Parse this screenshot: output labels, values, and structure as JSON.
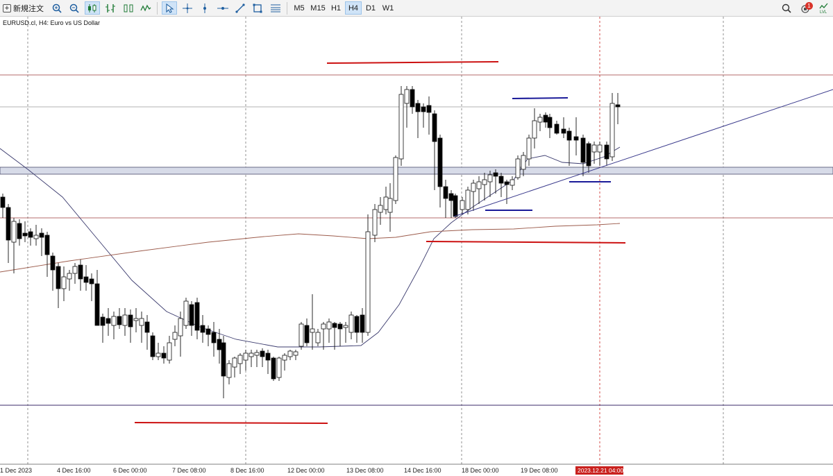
{
  "toolbar": {
    "new_order_label": "新規注文",
    "timeframes": [
      {
        "label": "M5",
        "active": false
      },
      {
        "label": "M15",
        "active": false
      },
      {
        "label": "H1",
        "active": false
      },
      {
        "label": "H4",
        "active": true
      },
      {
        "label": "D1",
        "active": false
      },
      {
        "label": "W1",
        "active": false
      }
    ],
    "notification_count": "1",
    "icons": [
      "zoom-in-icon",
      "zoom-out-icon",
      "candlestick-icon",
      "bar-chart-icon",
      "line-chart-icon",
      "indicator-icon",
      "cursor-icon",
      "crosshair-icon",
      "vertical-line-icon",
      "horizontal-line-icon",
      "trendline-icon",
      "rectangle-icon",
      "fibonacci-icon",
      "search-icon",
      "notification-icon",
      "level-icon"
    ]
  },
  "chart": {
    "symbol_label": "EURUSD.cl, H4:  Euro vs US Dollar",
    "time_labels": [
      "1 Dec 2023",
      "4 Dec 16:00",
      "6 Dec 00:00",
      "7 Dec 08:00",
      "8 Dec 16:00",
      "12 Dec 00:00",
      "13 Dec 08:00",
      "14 Dec 16:00",
      "18 Dec 00:00",
      "19 Dec 08:00"
    ],
    "current_time_label": "2023.12.21 04:00",
    "colors": {
      "red_marks": "#cc1111",
      "blue_marks": "#1a1a99",
      "trendline": "#3a3a8c",
      "fast_ma": "#3b3b6e",
      "slow_ma": "#9b5a4a",
      "zone": "#d7dbe8",
      "grid": "#777777",
      "time_highlight": "#c9211e"
    }
  }
}
